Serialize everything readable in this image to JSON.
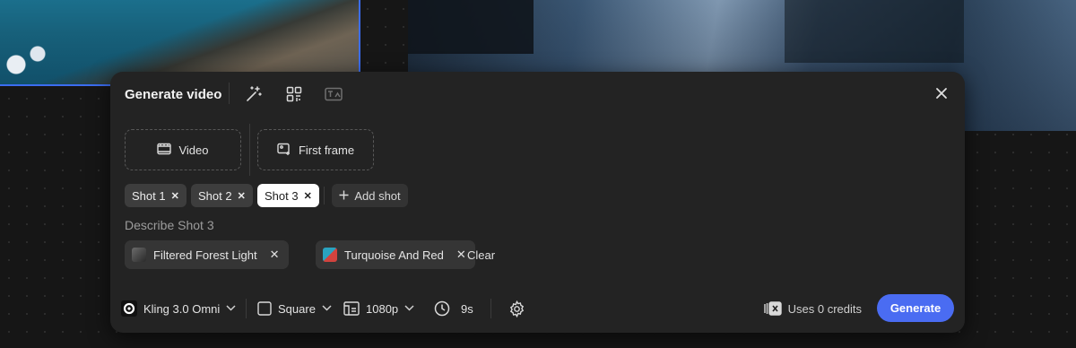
{
  "panel": {
    "title": "Generate video",
    "header_icons": [
      "magic-wand-icon",
      "qr-grid-icon",
      "image-text-icon"
    ],
    "close_icon": "close-icon"
  },
  "inputs": {
    "video_label": "Video",
    "first_frame_label": "First frame"
  },
  "shots": [
    {
      "label": "Shot 1",
      "active": false
    },
    {
      "label": "Shot 2",
      "active": false
    },
    {
      "label": "Shot 3",
      "active": true
    }
  ],
  "add_shot_label": "Add shot",
  "describe_label": "Describe Shot 3",
  "style_tags": [
    {
      "label": "Filtered Forest Light",
      "swatch_color": "#4a4a4a"
    },
    {
      "label": "Turquoise And Red",
      "swatch_color": "#2aa3c0"
    }
  ],
  "clear_label": "Clear",
  "settings": {
    "model_label": "Kling 3.0 Omni",
    "aspect_label": "Square",
    "resolution_label": "1080p",
    "duration_label": "9s"
  },
  "credits_label": "Uses 0 credits",
  "generate_label": "Generate",
  "colors": {
    "accent": "#4a6cf2",
    "panel_bg": "#232323",
    "chip_bg": "#3d3d3d",
    "selection_border": "#3b6df0"
  }
}
